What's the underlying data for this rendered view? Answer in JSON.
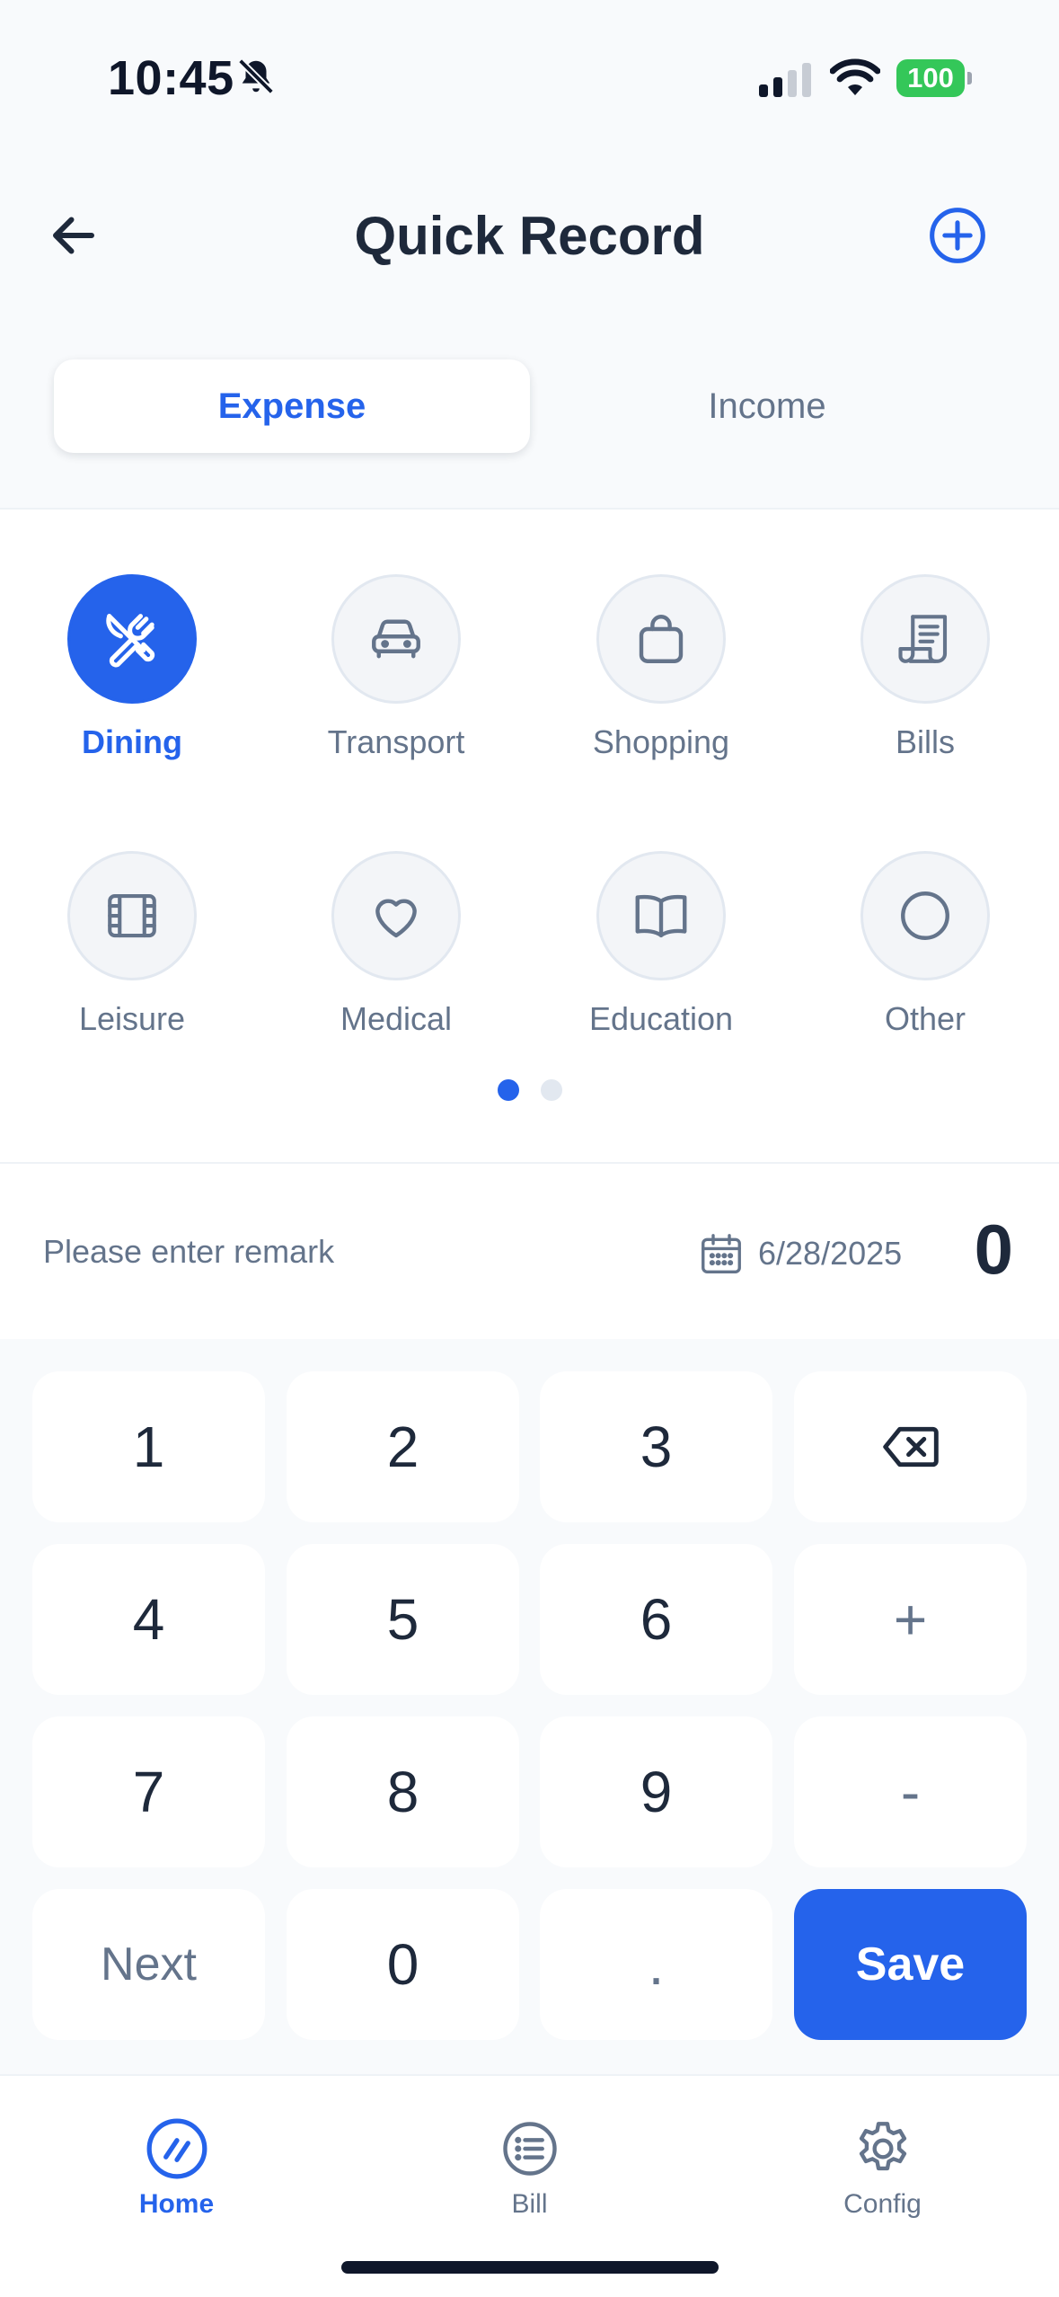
{
  "status_bar": {
    "time": "10:45",
    "battery": "100"
  },
  "header": {
    "title": "Quick Record"
  },
  "type_tabs": [
    {
      "label": "Expense",
      "active": true
    },
    {
      "label": "Income",
      "active": false
    }
  ],
  "categories": [
    {
      "label": "Dining",
      "icon": "fork-knife-icon",
      "active": true
    },
    {
      "label": "Transport",
      "icon": "car-icon",
      "active": false
    },
    {
      "label": "Shopping",
      "icon": "shopping-bag-icon",
      "active": false
    },
    {
      "label": "Bills",
      "icon": "receipt-icon",
      "active": false
    },
    {
      "label": "Leisure",
      "icon": "film-icon",
      "active": false
    },
    {
      "label": "Medical",
      "icon": "heart-icon",
      "active": false
    },
    {
      "label": "Education",
      "icon": "book-icon",
      "active": false
    },
    {
      "label": "Other",
      "icon": "circle-icon",
      "active": false
    }
  ],
  "pagination": {
    "pages": 2,
    "current": 1
  },
  "remark": {
    "placeholder": "Please enter remark",
    "value": ""
  },
  "date": "6/28/2025",
  "amount": "0",
  "keypad": {
    "k1": "1",
    "k2": "2",
    "k3": "3",
    "k4": "4",
    "k5": "5",
    "k6": "6",
    "k7": "7",
    "k8": "8",
    "k9": "9",
    "plus": "+",
    "minus": "-",
    "next": "Next",
    "k0": "0",
    "dot": ".",
    "save": "Save"
  },
  "bottom_nav": [
    {
      "label": "Home",
      "icon": "home-slash-icon",
      "active": true
    },
    {
      "label": "Bill",
      "icon": "list-icon",
      "active": false
    },
    {
      "label": "Config",
      "icon": "gear-icon",
      "active": false
    }
  ],
  "colors": {
    "primary": "#2563eb",
    "text_dark": "#1e293b",
    "text_muted": "#64748b",
    "background": "#f8fafc",
    "battery_green": "#34c759"
  }
}
